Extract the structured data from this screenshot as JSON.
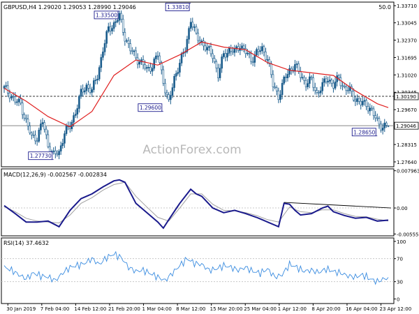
{
  "header": {
    "symbol_info": "GBPUSD,H4  1.29020 1.29053 1.28990 1.29046",
    "top_right": "50.0"
  },
  "watermark": "ActionForex.com",
  "colors": {
    "candle": "#1a5c8c",
    "ma": "#e02020",
    "macd": "#1a1a8c",
    "signal": "#a0a0a0",
    "rsi": "#3a8ce0",
    "grid": "#c8c8c8",
    "frame": "#000000",
    "label_box": "#1a1a8c",
    "text": "#000000",
    "watermark": "#b8b8b8"
  },
  "chart_data": [
    {
      "type": "candlestick",
      "title": "GBPUSD,H4",
      "ohlc_last": {
        "open": 1.2902,
        "high": 1.29053,
        "low": 1.2899,
        "close": 1.29046
      },
      "x_ticks": [
        "30 Jan 2019",
        "7 Feb 04:00",
        "14 Feb 12:00",
        "21 Feb 20:00",
        "1 Mar 04:00",
        "8 Mar 12:00",
        "15 Mar 20:00",
        "25 Mar 04:00",
        "1 Apr 12:00",
        "8 Apr 20:00",
        "16 Apr 04:00",
        "23 Apr 12:00"
      ],
      "y_ticks": [
        1.3371,
        1.33045,
        1.3237,
        1.31695,
        1.3102,
        1.30345,
        1.2967,
        1.28995,
        1.28315,
        1.2764
      ],
      "ylim": [
        1.2745,
        1.3385
      ],
      "price_path": [
        [
          0,
          1.305
        ],
        [
          3,
          1.303
        ],
        [
          6,
          1.3
        ],
        [
          9,
          1.299
        ],
        [
          12,
          1.292
        ],
        [
          15,
          1.286
        ],
        [
          18,
          1.286
        ],
        [
          21,
          1.292
        ],
        [
          24,
          1.283
        ],
        [
          27,
          1.279
        ],
        [
          30,
          1.28
        ],
        [
          33,
          1.288
        ],
        [
          36,
          1.29
        ],
        [
          39,
          1.296
        ],
        [
          42,
          1.303
        ],
        [
          45,
          1.306
        ],
        [
          48,
          1.304
        ],
        [
          51,
          1.31
        ],
        [
          54,
          1.32
        ],
        [
          57,
          1.328
        ],
        [
          60,
          1.33
        ],
        [
          63,
          1.333
        ],
        [
          66,
          1.325
        ],
        [
          69,
          1.32
        ],
        [
          72,
          1.317
        ],
        [
          75,
          1.315
        ],
        [
          78,
          1.312
        ],
        [
          81,
          1.314
        ],
        [
          84,
          1.318
        ],
        [
          87,
          1.308
        ],
        [
          90,
          1.299
        ],
        [
          93,
          1.309
        ],
        [
          96,
          1.315
        ],
        [
          99,
          1.32
        ],
        [
          102,
          1.332
        ],
        [
          105,
          1.325
        ],
        [
          108,
          1.323
        ],
        [
          111,
          1.32
        ],
        [
          114,
          1.318
        ],
        [
          117,
          1.31
        ],
        [
          120,
          1.318
        ],
        [
          123,
          1.32
        ],
        [
          126,
          1.319
        ],
        [
          129,
          1.322
        ],
        [
          132,
          1.319
        ],
        [
          135,
          1.316
        ],
        [
          138,
          1.319
        ],
        [
          141,
          1.32
        ],
        [
          144,
          1.317
        ],
        [
          147,
          1.306
        ],
        [
          150,
          1.302
        ],
        [
          153,
          1.308
        ],
        [
          156,
          1.312
        ],
        [
          159,
          1.314
        ],
        [
          162,
          1.31
        ],
        [
          165,
          1.307
        ],
        [
          168,
          1.308
        ],
        [
          171,
          1.303
        ],
        [
          174,
          1.306
        ],
        [
          177,
          1.309
        ],
        [
          180,
          1.306
        ],
        [
          183,
          1.309
        ],
        [
          186,
          1.305
        ],
        [
          189,
          1.304
        ],
        [
          192,
          1.301
        ],
        [
          195,
          1.299
        ],
        [
          198,
          1.299
        ],
        [
          201,
          1.296
        ],
        [
          204,
          1.292
        ],
        [
          207,
          1.29
        ],
        [
          210,
          1.2904
        ]
      ],
      "ma_path": [
        [
          0,
          1.305
        ],
        [
          12,
          1.3
        ],
        [
          24,
          1.294
        ],
        [
          36,
          1.29
        ],
        [
          48,
          1.296
        ],
        [
          60,
          1.31
        ],
        [
          72,
          1.316
        ],
        [
          84,
          1.314
        ],
        [
          96,
          1.318
        ],
        [
          108,
          1.323
        ],
        [
          120,
          1.321
        ],
        [
          132,
          1.32
        ],
        [
          144,
          1.315
        ],
        [
          156,
          1.312
        ],
        [
          168,
          1.311
        ],
        [
          180,
          1.31
        ],
        [
          192,
          1.304
        ],
        [
          204,
          1.299
        ],
        [
          210,
          1.2975
        ]
      ],
      "horizontal_levels": [
        {
          "value": 1.3019,
          "style": "dashed",
          "label": "1.30190"
        },
        {
          "value": 1.29046,
          "style": "solid",
          "label": "1.29046"
        }
      ],
      "annotations": [
        {
          "label": "1.33500",
          "bar": 63,
          "price": 1.335
        },
        {
          "label": "1.33810",
          "bar": 102,
          "price": 1.3381
        },
        {
          "label": "1.29600",
          "bar": 87,
          "price": 1.296
        },
        {
          "label": "1.27730",
          "bar": 27,
          "price": 1.2773
        },
        {
          "label": "1.28650",
          "bar": 204,
          "price": 1.2865
        }
      ]
    },
    {
      "type": "line",
      "title": "MACD(12,26,9) -0.002567 -0.002834",
      "y_ticks": [
        "0.007963",
        "0.00",
        "-0.005559"
      ],
      "ylim": [
        -0.005559,
        0.007963
      ],
      "macd_path": [
        [
          0,
          0.0005
        ],
        [
          6,
          -0.0012
        ],
        [
          12,
          -0.003
        ],
        [
          18,
          -0.003
        ],
        [
          24,
          -0.0028
        ],
        [
          30,
          -0.004
        ],
        [
          36,
          -0.0005
        ],
        [
          42,
          0.002
        ],
        [
          48,
          0.003
        ],
        [
          54,
          0.0045
        ],
        [
          60,
          0.0058
        ],
        [
          63,
          0.006
        ],
        [
          66,
          0.0055
        ],
        [
          72,
          0.001
        ],
        [
          78,
          -0.001
        ],
        [
          84,
          -0.003
        ],
        [
          87,
          -0.0043
        ],
        [
          90,
          -0.0025
        ],
        [
          96,
          0.001
        ],
        [
          102,
          0.004
        ],
        [
          105,
          0.003
        ],
        [
          108,
          0.0025
        ],
        [
          114,
          0.0
        ],
        [
          120,
          -0.001
        ],
        [
          126,
          -0.0005
        ],
        [
          132,
          -0.0012
        ],
        [
          138,
          -0.002
        ],
        [
          141,
          -0.0025
        ],
        [
          144,
          -0.003
        ],
        [
          150,
          -0.004
        ],
        [
          153,
          0.001
        ],
        [
          156,
          0.0008
        ],
        [
          159,
          -0.0005
        ],
        [
          162,
          -0.0015
        ],
        [
          168,
          -0.0012
        ],
        [
          174,
          0.0
        ],
        [
          177,
          0.0004
        ],
        [
          180,
          -0.0008
        ],
        [
          186,
          -0.0016
        ],
        [
          192,
          -0.0022
        ],
        [
          198,
          -0.002
        ],
        [
          204,
          -0.0028
        ],
        [
          210,
          -0.0026
        ]
      ],
      "signal_path": [
        [
          0,
          0.0003
        ],
        [
          6,
          -0.0008
        ],
        [
          12,
          -0.0022
        ],
        [
          18,
          -0.0028
        ],
        [
          24,
          -0.003
        ],
        [
          30,
          -0.0032
        ],
        [
          36,
          -0.0015
        ],
        [
          42,
          0.001
        ],
        [
          48,
          0.0022
        ],
        [
          54,
          0.0038
        ],
        [
          60,
          0.005
        ],
        [
          66,
          0.0055
        ],
        [
          72,
          0.0025
        ],
        [
          78,
          0.0002
        ],
        [
          84,
          -0.002
        ],
        [
          90,
          -0.0028
        ],
        [
          96,
          0.0
        ],
        [
          102,
          0.003
        ],
        [
          108,
          0.003
        ],
        [
          114,
          0.0008
        ],
        [
          120,
          -0.0005
        ],
        [
          126,
          -0.0006
        ],
        [
          132,
          -0.001
        ],
        [
          138,
          -0.0016
        ],
        [
          144,
          -0.0025
        ],
        [
          150,
          -0.003
        ],
        [
          156,
          0.0002
        ],
        [
          162,
          -0.0008
        ],
        [
          168,
          -0.001
        ],
        [
          174,
          -0.0004
        ],
        [
          180,
          -0.0004
        ],
        [
          186,
          -0.0012
        ],
        [
          192,
          -0.0018
        ],
        [
          198,
          -0.0019
        ],
        [
          204,
          -0.0024
        ],
        [
          210,
          -0.0028
        ]
      ],
      "trendline": [
        [
          153,
          0.0012
        ],
        [
          210,
          0.0
        ]
      ]
    },
    {
      "type": "line",
      "title": "RSI(14) 37.4632",
      "y_ticks": [
        "100",
        "70",
        "30",
        "0"
      ],
      "ylim": [
        0,
        100
      ],
      "rsi_path": [
        [
          0,
          55
        ],
        [
          4,
          50
        ],
        [
          8,
          42
        ],
        [
          12,
          35
        ],
        [
          16,
          45
        ],
        [
          20,
          40
        ],
        [
          24,
          38
        ],
        [
          28,
          32
        ],
        [
          32,
          45
        ],
        [
          36,
          55
        ],
        [
          40,
          58
        ],
        [
          44,
          62
        ],
        [
          48,
          70
        ],
        [
          52,
          60
        ],
        [
          56,
          72
        ],
        [
          60,
          78
        ],
        [
          64,
          72
        ],
        [
          68,
          55
        ],
        [
          72,
          48
        ],
        [
          76,
          50
        ],
        [
          80,
          44
        ],
        [
          84,
          38
        ],
        [
          88,
          32
        ],
        [
          92,
          45
        ],
        [
          96,
          58
        ],
        [
          100,
          70
        ],
        [
          104,
          62
        ],
        [
          108,
          60
        ],
        [
          112,
          50
        ],
        [
          116,
          52
        ],
        [
          120,
          58
        ],
        [
          124,
          55
        ],
        [
          128,
          50
        ],
        [
          132,
          55
        ],
        [
          136,
          48
        ],
        [
          140,
          45
        ],
        [
          144,
          52
        ],
        [
          148,
          38
        ],
        [
          152,
          42
        ],
        [
          156,
          60
        ],
        [
          160,
          55
        ],
        [
          164,
          48
        ],
        [
          168,
          50
        ],
        [
          172,
          46
        ],
        [
          176,
          52
        ],
        [
          180,
          48
        ],
        [
          184,
          45
        ],
        [
          188,
          40
        ],
        [
          192,
          38
        ],
        [
          196,
          42
        ],
        [
          200,
          35
        ],
        [
          204,
          30
        ],
        [
          207,
          34
        ],
        [
          210,
          37.46
        ]
      ]
    }
  ]
}
